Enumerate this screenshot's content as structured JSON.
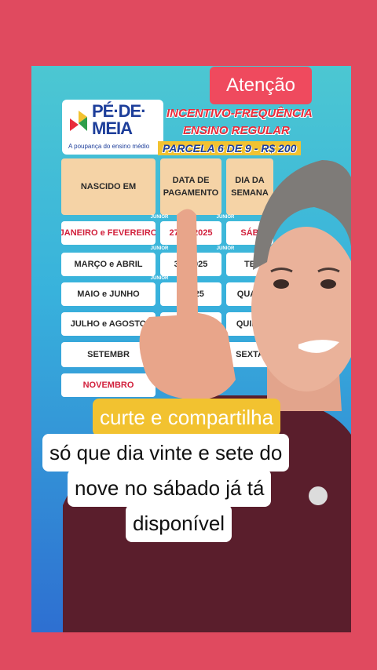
{
  "badge": "Atenção",
  "logo": {
    "name_line1": "PÉ·DE·",
    "name_line2": "MEIA",
    "tagline": "A poupança do ensino médio"
  },
  "header": {
    "line1": "INCENTIVO-FREQUÊNCIA",
    "line2": "ENSINO REGULAR",
    "line3": "PARCELA 6 DE 9 - R$ 200"
  },
  "table": {
    "col1": "NASCIDO EM",
    "col2a": "DATA DE",
    "col2b": "PAGAMENTO",
    "col3a": "DIA DA",
    "col3b": "SEMANA",
    "rows": [
      {
        "born": "JANEIRO e FEVEREIRO",
        "date": "27/09/2025",
        "day": "SÁB"
      },
      {
        "born": "MARÇO e ABRIL",
        "date": "30/  2025",
        "day": "TE"
      },
      {
        "born": "MAIO e JUNHO",
        "date": "0  2025",
        "day": "QUAR"
      },
      {
        "born": "JULHO e AGOSTO",
        "date": "/2025",
        "day": "QUINT"
      },
      {
        "born": "SETEMBR",
        "date": "2025",
        "day": "SEXTA"
      },
      {
        "born": "NOVEMBRO",
        "date": "",
        "day": ""
      }
    ],
    "watermark": "JUNIOR"
  },
  "captions": {
    "line0": "curte e compartilha",
    "line1": "só que dia vinte e sete do",
    "line2": "nove no sábado já tá",
    "line3": "disponível"
  },
  "colors": {
    "background": "#e04a5f",
    "badge": "#ef4a5e",
    "highlight": "#f2c230",
    "header_red": "#e92c3a"
  }
}
